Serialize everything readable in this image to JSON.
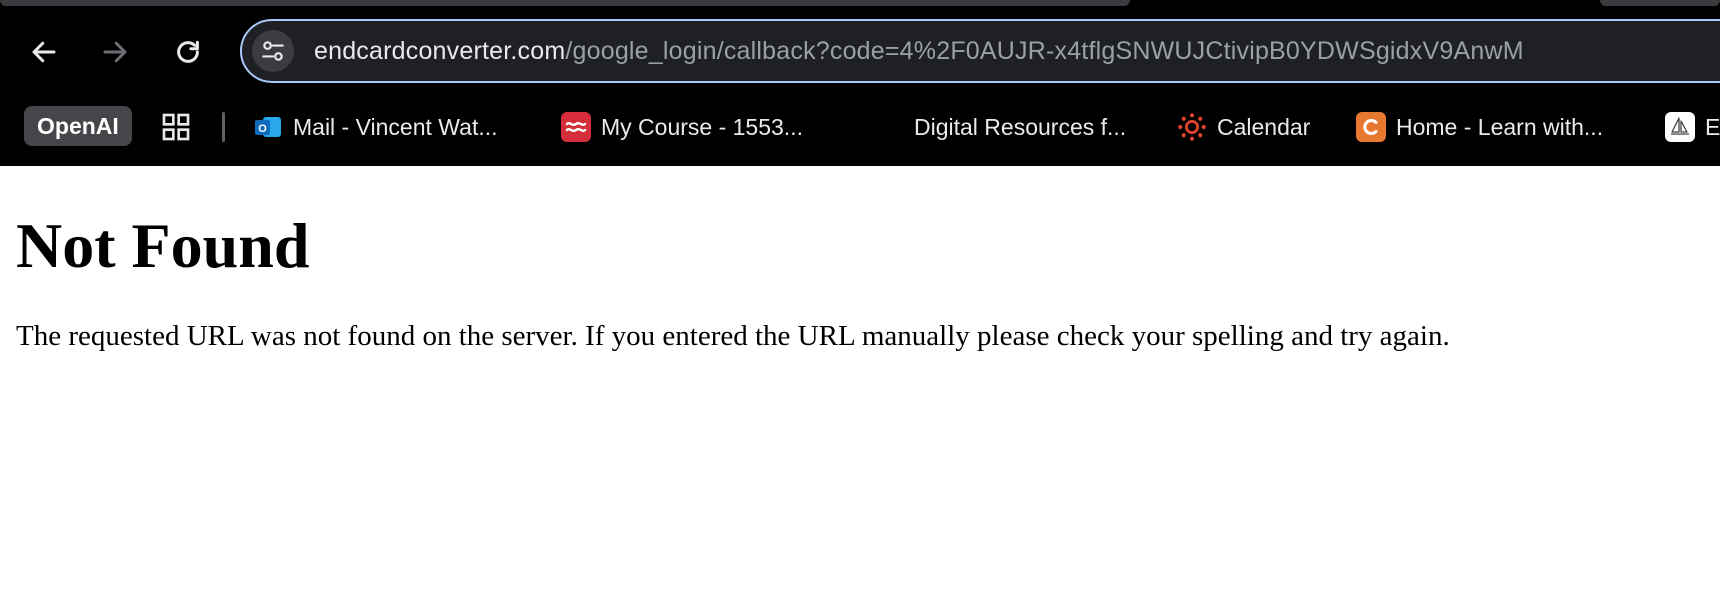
{
  "browser": {
    "address_bar": {
      "host": "endcardconverter.com",
      "path": "/google_login/callback?code=4%2F0AUJR-x4tflgSNWUJCtivipB0YDWSgidxV9AnwM"
    },
    "bookmarks": {
      "profile_label": "OpenAI",
      "items": [
        {
          "label": "Mail - Vincent Wat...",
          "icon": "outlook-icon"
        },
        {
          "label": "My Course - 1553...",
          "icon": "course-icon"
        },
        {
          "label": "Digital Resources f...",
          "icon": "none"
        },
        {
          "label": "Calendar",
          "icon": "canvas-icon"
        },
        {
          "label": "Home - Learn with...",
          "icon": "c-logo-icon"
        },
        {
          "label": "E",
          "icon": "sailboat-icon"
        }
      ]
    }
  },
  "page": {
    "heading": "Not Found",
    "message": "The requested URL was not found on the server. If you entered the URL manually please check your spelling and try again."
  },
  "colors": {
    "chrome_background": "#000000",
    "omnibox_background": "#1f2024",
    "omnibox_border": "#a8c7fa",
    "outlook_blue": "#0f6cbd",
    "course_red": "#d62d3a",
    "canvas_red": "#e4422c",
    "c_logo_orange": "#e67830"
  }
}
